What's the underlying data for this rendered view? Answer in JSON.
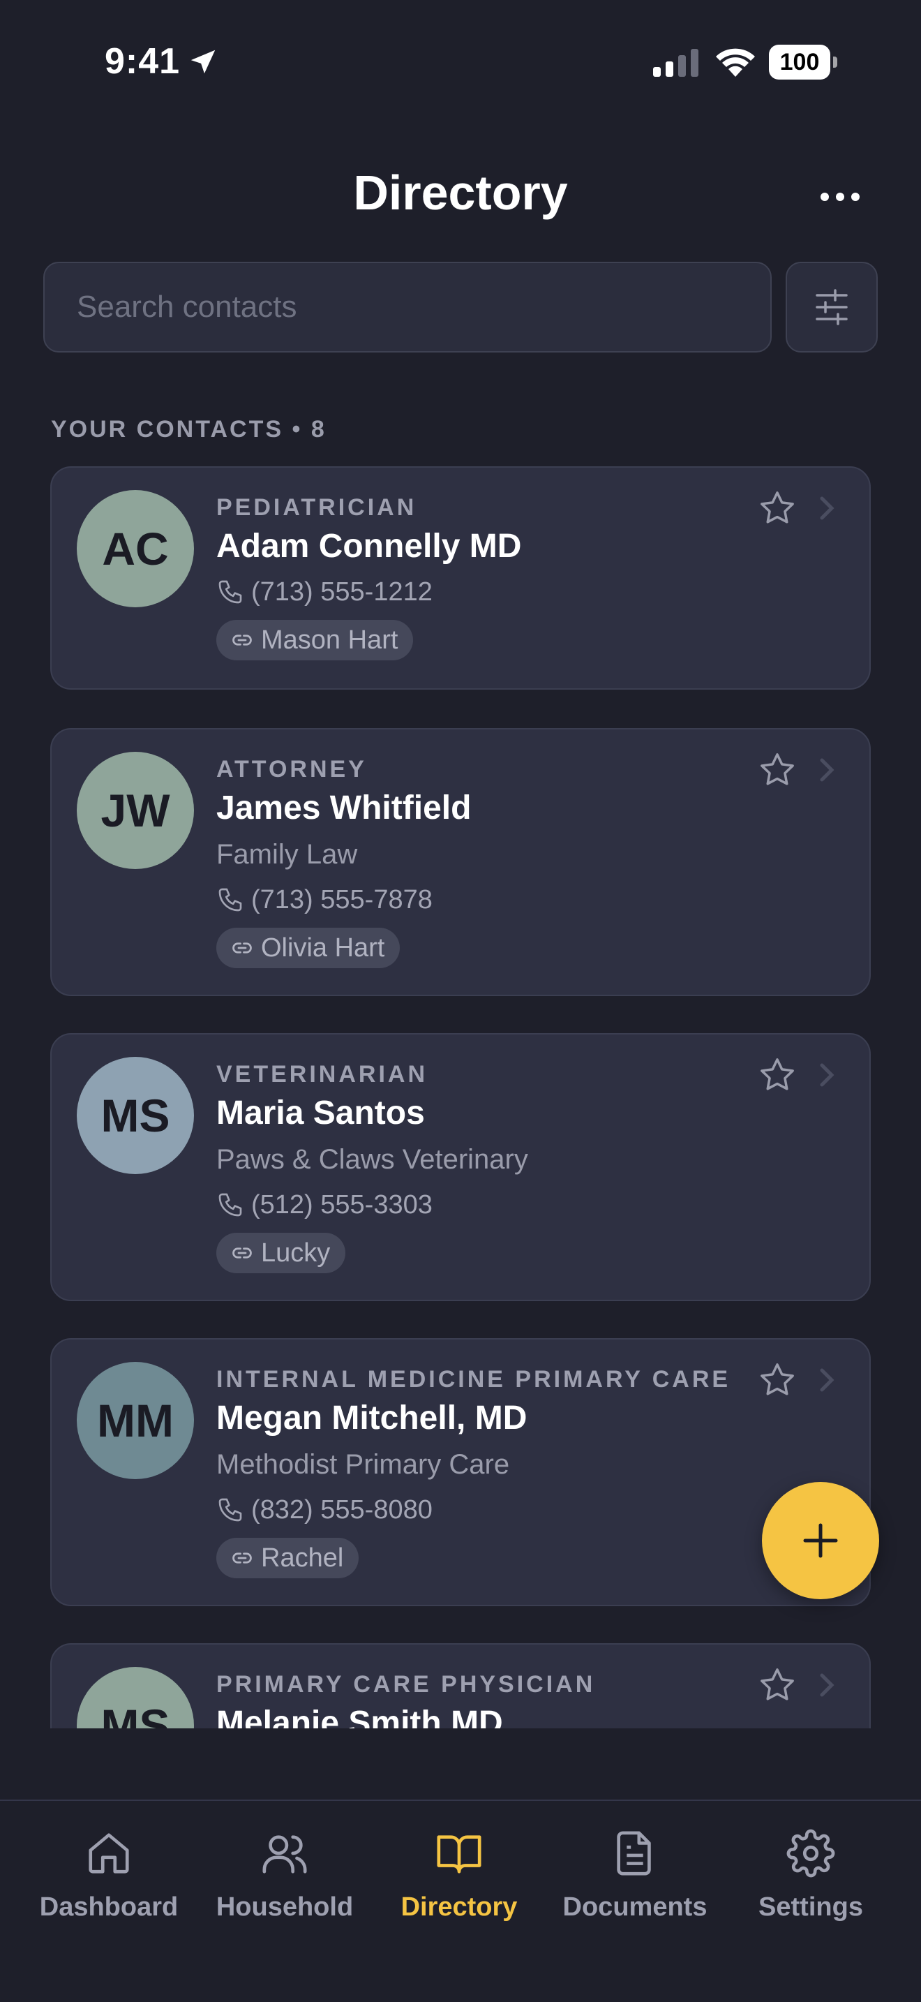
{
  "status_bar": {
    "time": "9:41",
    "battery": "100"
  },
  "header": {
    "title": "Directory"
  },
  "search": {
    "placeholder": "Search contacts"
  },
  "section": {
    "label": "YOUR CONTACTS • 8"
  },
  "contacts": [
    {
      "initials": "AC",
      "role": "PEDIATRICIAN",
      "name": "Adam Connelly MD",
      "org": "",
      "phone": "(713) 555-1212",
      "tag": "Mason Hart",
      "avatar_color": "#8fa59a"
    },
    {
      "initials": "JW",
      "role": "ATTORNEY",
      "name": "James Whitfield",
      "org": "Family Law",
      "phone": "(713) 555-7878",
      "tag": "Olivia Hart",
      "avatar_color": "#8fa59a"
    },
    {
      "initials": "MS",
      "role": "VETERINARIAN",
      "name": "Maria Santos",
      "org": "Paws & Claws Veterinary",
      "phone": "(512) 555-3303",
      "tag": "Lucky",
      "avatar_color": "#8ea2b2"
    },
    {
      "initials": "MM",
      "role": "INTERNAL MEDICINE PRIMARY CARE",
      "name": "Megan Mitchell, MD",
      "org": "Methodist Primary Care",
      "phone": "(832) 555-8080",
      "tag": "Rachel",
      "avatar_color": "#6f8a93"
    },
    {
      "initials": "MS",
      "role": "PRIMARY CARE PHYSICIAN",
      "name": "Melanie Smith MD",
      "org": "",
      "phone": "",
      "tag": "",
      "avatar_color": "#8fa59a"
    }
  ],
  "tabs": [
    {
      "label": "Dashboard",
      "icon": "home-icon"
    },
    {
      "label": "Household",
      "icon": "users-icon"
    },
    {
      "label": "Directory",
      "icon": "book-open-icon",
      "active": true
    },
    {
      "label": "Documents",
      "icon": "document-icon"
    },
    {
      "label": "Settings",
      "icon": "gear-icon"
    }
  ],
  "colors": {
    "accent": "#f5c443",
    "background": "#1e1f2a",
    "card": "#2e3042"
  }
}
